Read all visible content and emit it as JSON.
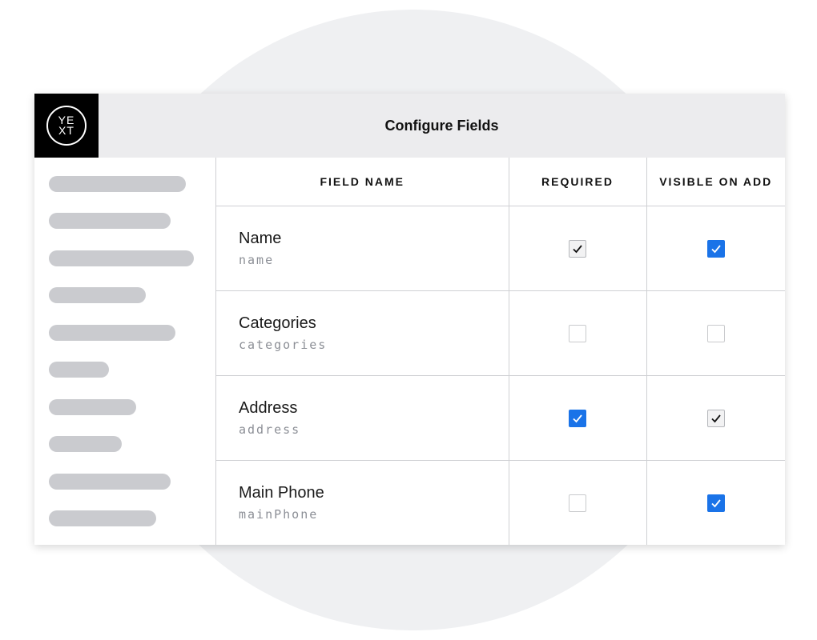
{
  "colors": {
    "background_circle": "#eff0f2",
    "header_bg": "#ececee",
    "logo_bg": "#000000",
    "checkbox_blue": "#1a73e8",
    "checkbox_gray_checked": "#f2f2f3",
    "sidebar_placeholder": "#cacbcf"
  },
  "header": {
    "logo_text": "YE\nXT",
    "title": "Configure Fields"
  },
  "sidebar": {
    "placeholder_count": 10
  },
  "table": {
    "columns": {
      "field_name": "FIELD NAME",
      "required": "REQUIRED",
      "visible_on_add": "VISIBLE ON ADD"
    },
    "rows": [
      {
        "label": "Name",
        "key": "name",
        "required": {
          "checked": true,
          "style": "gray"
        },
        "visible_on_add": {
          "checked": true,
          "style": "blue"
        }
      },
      {
        "label": "Categories",
        "key": "categories",
        "required": {
          "checked": false,
          "style": "none"
        },
        "visible_on_add": {
          "checked": false,
          "style": "none"
        }
      },
      {
        "label": "Address",
        "key": "address",
        "required": {
          "checked": true,
          "style": "blue"
        },
        "visible_on_add": {
          "checked": true,
          "style": "gray"
        }
      },
      {
        "label": "Main Phone",
        "key": "mainPhone",
        "required": {
          "checked": false,
          "style": "none"
        },
        "visible_on_add": {
          "checked": true,
          "style": "blue"
        }
      }
    ]
  }
}
